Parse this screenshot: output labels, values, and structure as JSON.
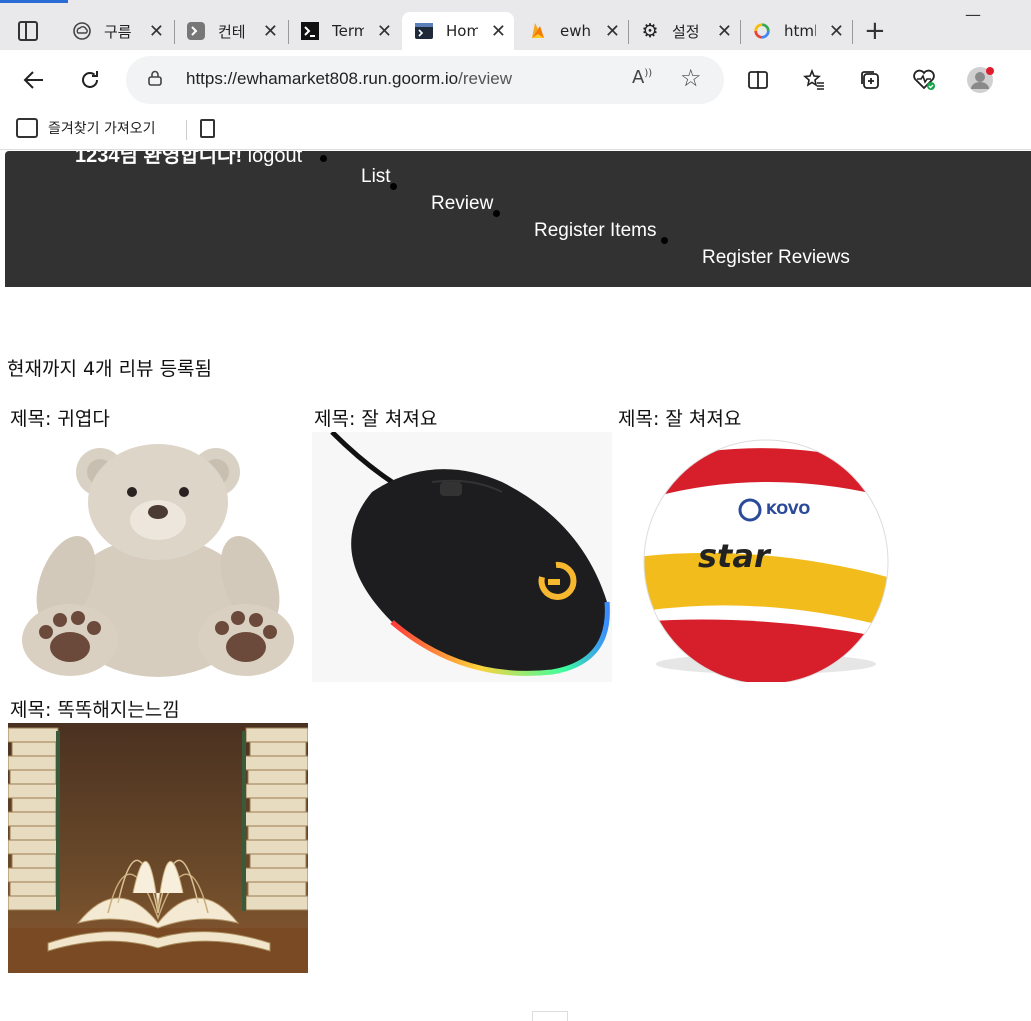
{
  "browser": {
    "tabs": [
      {
        "label": "구름",
        "icon": "cloud-icon"
      },
      {
        "label": "컨테",
        "icon": "terminal-icon"
      },
      {
        "label": "Term",
        "icon": "terminal-icon"
      },
      {
        "label": "Hom",
        "icon": "terminal-icon",
        "active": true
      },
      {
        "label": "ewha",
        "icon": "firebase-icon"
      },
      {
        "label": "설정",
        "icon": "gear-icon"
      },
      {
        "label": "html",
        "icon": "google-icon"
      }
    ],
    "url_host": "https://ewhamarket808.run.goorm.io",
    "url_path": "/review",
    "favorites_label": "즐겨찾기 가져오기"
  },
  "nav": {
    "greeting": "1234님 환영합니다!",
    "logout": "logout",
    "links": [
      "List",
      "Review",
      "Register Items",
      "Register Reviews"
    ]
  },
  "main": {
    "icon_glyph": "",
    "count_text": "현재까지 4개 리뷰 등록됨",
    "reviews": [
      {
        "title": "제목: 귀엽다",
        "image": "teddy-bear"
      },
      {
        "title": "제목: 잘 쳐져요",
        "image": "gaming-mouse"
      },
      {
        "title": "제목: 잘 쳐져요",
        "image": "volleyball"
      },
      {
        "title": "제목: 똑똑해지는느낌",
        "image": "books"
      }
    ],
    "volleyball_text": {
      "brand": "star",
      "league": "KOVO"
    }
  },
  "colors": {
    "nav_bg": "#323232",
    "link": "#1a0dab",
    "tab_bar": "#e9e9ec"
  }
}
